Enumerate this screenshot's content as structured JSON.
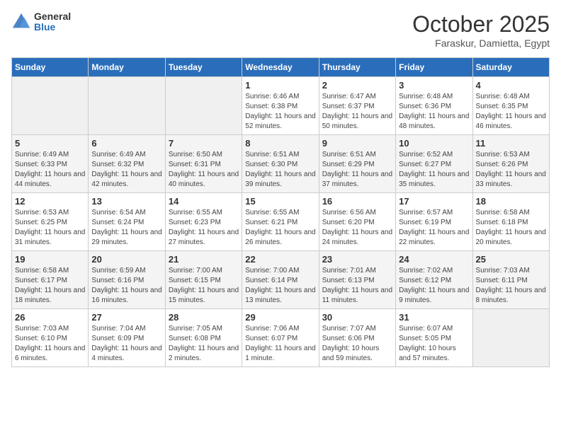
{
  "header": {
    "logo_general": "General",
    "logo_blue": "Blue",
    "month_title": "October 2025",
    "location": "Faraskur, Damietta, Egypt"
  },
  "weekdays": [
    "Sunday",
    "Monday",
    "Tuesday",
    "Wednesday",
    "Thursday",
    "Friday",
    "Saturday"
  ],
  "weeks": [
    [
      {
        "day": "",
        "info": ""
      },
      {
        "day": "",
        "info": ""
      },
      {
        "day": "",
        "info": ""
      },
      {
        "day": "1",
        "info": "Sunrise: 6:46 AM\nSunset: 6:38 PM\nDaylight: 11 hours\nand 52 minutes."
      },
      {
        "day": "2",
        "info": "Sunrise: 6:47 AM\nSunset: 6:37 PM\nDaylight: 11 hours\nand 50 minutes."
      },
      {
        "day": "3",
        "info": "Sunrise: 6:48 AM\nSunset: 6:36 PM\nDaylight: 11 hours\nand 48 minutes."
      },
      {
        "day": "4",
        "info": "Sunrise: 6:48 AM\nSunset: 6:35 PM\nDaylight: 11 hours\nand 46 minutes."
      }
    ],
    [
      {
        "day": "5",
        "info": "Sunrise: 6:49 AM\nSunset: 6:33 PM\nDaylight: 11 hours\nand 44 minutes."
      },
      {
        "day": "6",
        "info": "Sunrise: 6:49 AM\nSunset: 6:32 PM\nDaylight: 11 hours\nand 42 minutes."
      },
      {
        "day": "7",
        "info": "Sunrise: 6:50 AM\nSunset: 6:31 PM\nDaylight: 11 hours\nand 40 minutes."
      },
      {
        "day": "8",
        "info": "Sunrise: 6:51 AM\nSunset: 6:30 PM\nDaylight: 11 hours\nand 39 minutes."
      },
      {
        "day": "9",
        "info": "Sunrise: 6:51 AM\nSunset: 6:29 PM\nDaylight: 11 hours\nand 37 minutes."
      },
      {
        "day": "10",
        "info": "Sunrise: 6:52 AM\nSunset: 6:27 PM\nDaylight: 11 hours\nand 35 minutes."
      },
      {
        "day": "11",
        "info": "Sunrise: 6:53 AM\nSunset: 6:26 PM\nDaylight: 11 hours\nand 33 minutes."
      }
    ],
    [
      {
        "day": "12",
        "info": "Sunrise: 6:53 AM\nSunset: 6:25 PM\nDaylight: 11 hours\nand 31 minutes."
      },
      {
        "day": "13",
        "info": "Sunrise: 6:54 AM\nSunset: 6:24 PM\nDaylight: 11 hours\nand 29 minutes."
      },
      {
        "day": "14",
        "info": "Sunrise: 6:55 AM\nSunset: 6:23 PM\nDaylight: 11 hours\nand 27 minutes."
      },
      {
        "day": "15",
        "info": "Sunrise: 6:55 AM\nSunset: 6:21 PM\nDaylight: 11 hours\nand 26 minutes."
      },
      {
        "day": "16",
        "info": "Sunrise: 6:56 AM\nSunset: 6:20 PM\nDaylight: 11 hours\nand 24 minutes."
      },
      {
        "day": "17",
        "info": "Sunrise: 6:57 AM\nSunset: 6:19 PM\nDaylight: 11 hours\nand 22 minutes."
      },
      {
        "day": "18",
        "info": "Sunrise: 6:58 AM\nSunset: 6:18 PM\nDaylight: 11 hours\nand 20 minutes."
      }
    ],
    [
      {
        "day": "19",
        "info": "Sunrise: 6:58 AM\nSunset: 6:17 PM\nDaylight: 11 hours\nand 18 minutes."
      },
      {
        "day": "20",
        "info": "Sunrise: 6:59 AM\nSunset: 6:16 PM\nDaylight: 11 hours\nand 16 minutes."
      },
      {
        "day": "21",
        "info": "Sunrise: 7:00 AM\nSunset: 6:15 PM\nDaylight: 11 hours\nand 15 minutes."
      },
      {
        "day": "22",
        "info": "Sunrise: 7:00 AM\nSunset: 6:14 PM\nDaylight: 11 hours\nand 13 minutes."
      },
      {
        "day": "23",
        "info": "Sunrise: 7:01 AM\nSunset: 6:13 PM\nDaylight: 11 hours\nand 11 minutes."
      },
      {
        "day": "24",
        "info": "Sunrise: 7:02 AM\nSunset: 6:12 PM\nDaylight: 11 hours\nand 9 minutes."
      },
      {
        "day": "25",
        "info": "Sunrise: 7:03 AM\nSunset: 6:11 PM\nDaylight: 11 hours\nand 8 minutes."
      }
    ],
    [
      {
        "day": "26",
        "info": "Sunrise: 7:03 AM\nSunset: 6:10 PM\nDaylight: 11 hours\nand 6 minutes."
      },
      {
        "day": "27",
        "info": "Sunrise: 7:04 AM\nSunset: 6:09 PM\nDaylight: 11 hours\nand 4 minutes."
      },
      {
        "day": "28",
        "info": "Sunrise: 7:05 AM\nSunset: 6:08 PM\nDaylight: 11 hours\nand 2 minutes."
      },
      {
        "day": "29",
        "info": "Sunrise: 7:06 AM\nSunset: 6:07 PM\nDaylight: 11 hours\nand 1 minute."
      },
      {
        "day": "30",
        "info": "Sunrise: 7:07 AM\nSunset: 6:06 PM\nDaylight: 10 hours\nand 59 minutes."
      },
      {
        "day": "31",
        "info": "Sunrise: 6:07 AM\nSunset: 5:05 PM\nDaylight: 10 hours\nand 57 minutes."
      },
      {
        "day": "",
        "info": ""
      }
    ]
  ]
}
